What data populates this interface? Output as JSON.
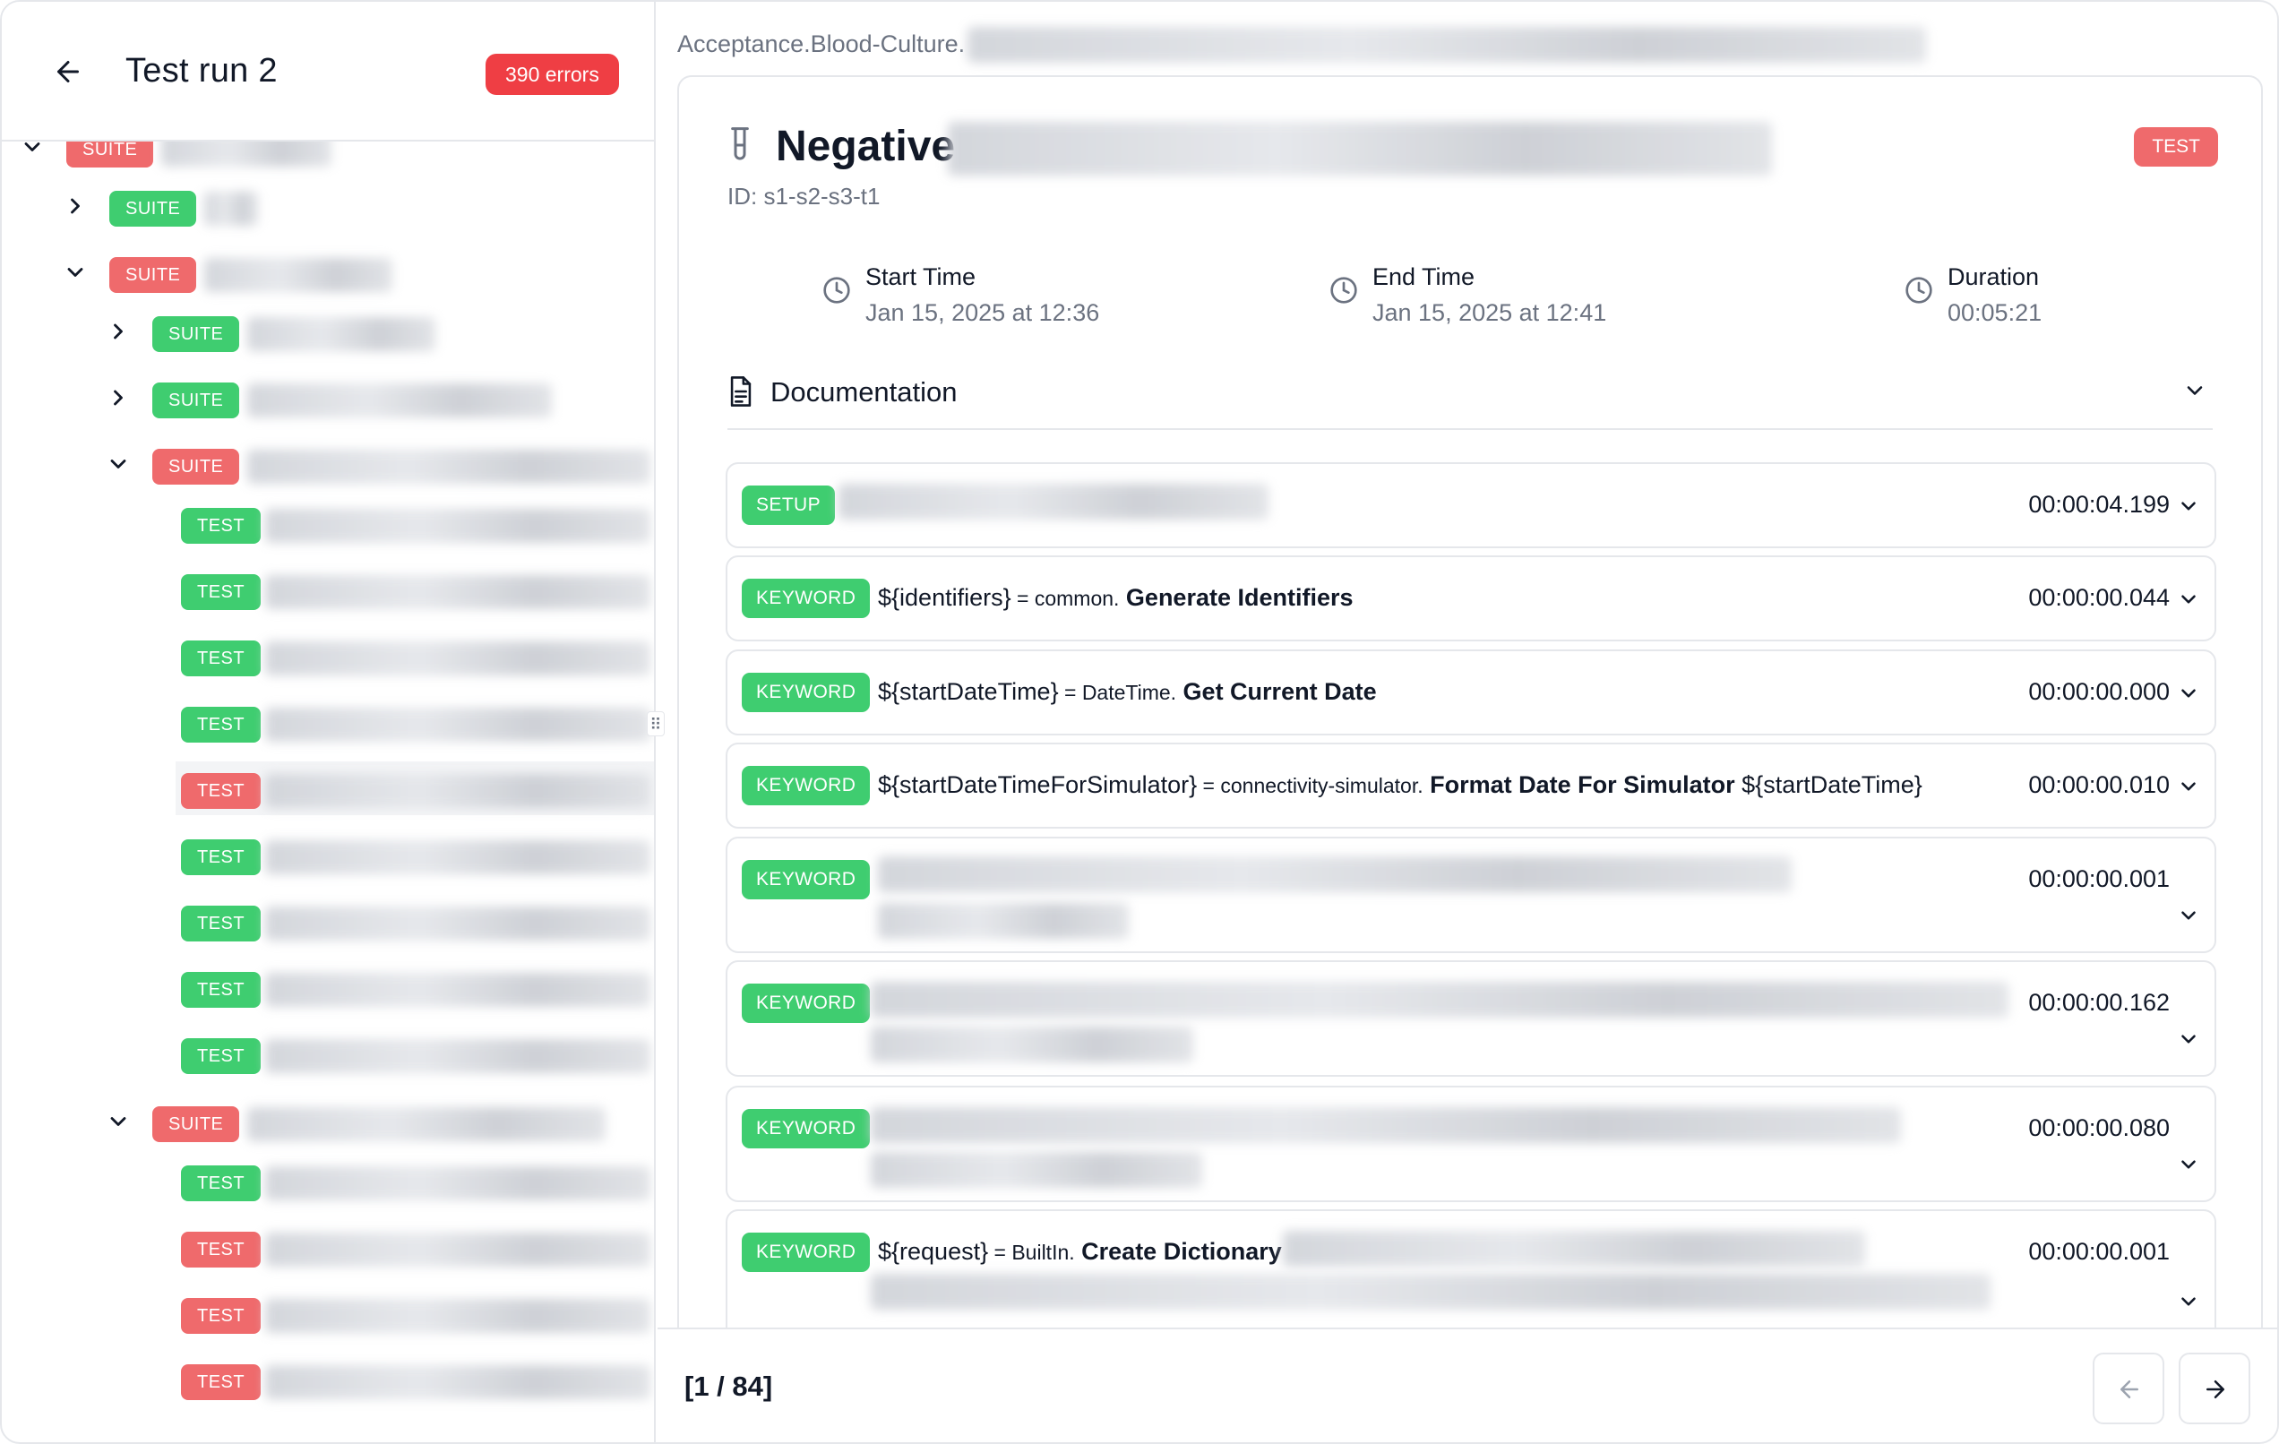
{
  "sidebar": {
    "title": "Test run 2",
    "errors_badge": "390 errors",
    "badge_labels": {
      "suite": "SUITE",
      "test": "TEST"
    },
    "tree": [
      {
        "type": "suite",
        "status": "failed",
        "expanded": true
      },
      {
        "type": "suite",
        "status": "passed",
        "expanded": false
      },
      {
        "type": "suite",
        "status": "failed",
        "expanded": true
      },
      {
        "type": "suite",
        "status": "passed",
        "expanded": false
      },
      {
        "type": "suite",
        "status": "passed",
        "expanded": false
      },
      {
        "type": "suite",
        "status": "failed",
        "expanded": true
      },
      {
        "type": "test",
        "status": "passed"
      },
      {
        "type": "test",
        "status": "passed"
      },
      {
        "type": "test",
        "status": "passed"
      },
      {
        "type": "test",
        "status": "passed"
      },
      {
        "type": "test",
        "status": "failed",
        "selected": true
      },
      {
        "type": "test",
        "status": "passed"
      },
      {
        "type": "test",
        "status": "passed"
      },
      {
        "type": "test",
        "status": "passed"
      },
      {
        "type": "test",
        "status": "passed"
      },
      {
        "type": "suite",
        "status": "failed",
        "expanded": true
      },
      {
        "type": "test",
        "status": "passed"
      },
      {
        "type": "test",
        "status": "failed"
      },
      {
        "type": "test",
        "status": "failed"
      },
      {
        "type": "test",
        "status": "failed"
      }
    ]
  },
  "breadcrumb": "Acceptance.Blood-Culture.",
  "test": {
    "title": "Negative",
    "id": "ID: s1-s2-s3-t1",
    "badge": "TEST",
    "start_label": "Start Time",
    "start_value": "Jan 15, 2025 at 12:36",
    "end_label": "End Time",
    "end_value": "Jan 15, 2025 at 12:41",
    "duration_label": "Duration",
    "duration_value": "00:05:21",
    "documentation_label": "Documentation"
  },
  "keywords": [
    {
      "badge": "SETUP",
      "duration": "00:00:04.199"
    },
    {
      "badge": "KEYWORD",
      "var": "${identifiers}",
      "eq": "=",
      "lib": "common.",
      "name": "Generate Identifiers",
      "args": "",
      "duration": "00:00:00.044"
    },
    {
      "badge": "KEYWORD",
      "var": "${startDateTime}",
      "eq": "=",
      "lib": "DateTime.",
      "name": "Get Current Date",
      "args": "",
      "duration": "00:00:00.000"
    },
    {
      "badge": "KEYWORD",
      "var": "${startDateTimeForSimulator}",
      "eq": "=",
      "lib": "connectivity-simulator.",
      "name": "Format Date For Simulator",
      "args": "${startDateTime}",
      "duration": "00:00:00.010"
    },
    {
      "badge": "KEYWORD",
      "duration": "00:00:00.001"
    },
    {
      "badge": "KEYWORD",
      "duration": "00:00:00.162"
    },
    {
      "badge": "KEYWORD",
      "duration": "00:00:00.080"
    },
    {
      "badge": "KEYWORD",
      "var": "${request}",
      "eq": "=",
      "lib": "BuiltIn.",
      "name": "Create Dictionary",
      "args": "",
      "duration": "00:00:00.001"
    }
  ],
  "footer": {
    "pager": "[1 / 84]"
  },
  "colors": {
    "passed": "#3fcd70",
    "failed": "#ef6a6c",
    "error_badge": "#ef3e44",
    "border": "#e5e7eb",
    "muted": "#6b7280"
  },
  "icons": {
    "back": "arrow-left-icon",
    "expand": "chevron-down-icon",
    "collapse": "chevron-right-icon",
    "clock": "clock-icon",
    "doc": "document-icon",
    "test": "test-tube-icon",
    "prev": "arrow-left-icon",
    "next": "arrow-right-icon"
  }
}
